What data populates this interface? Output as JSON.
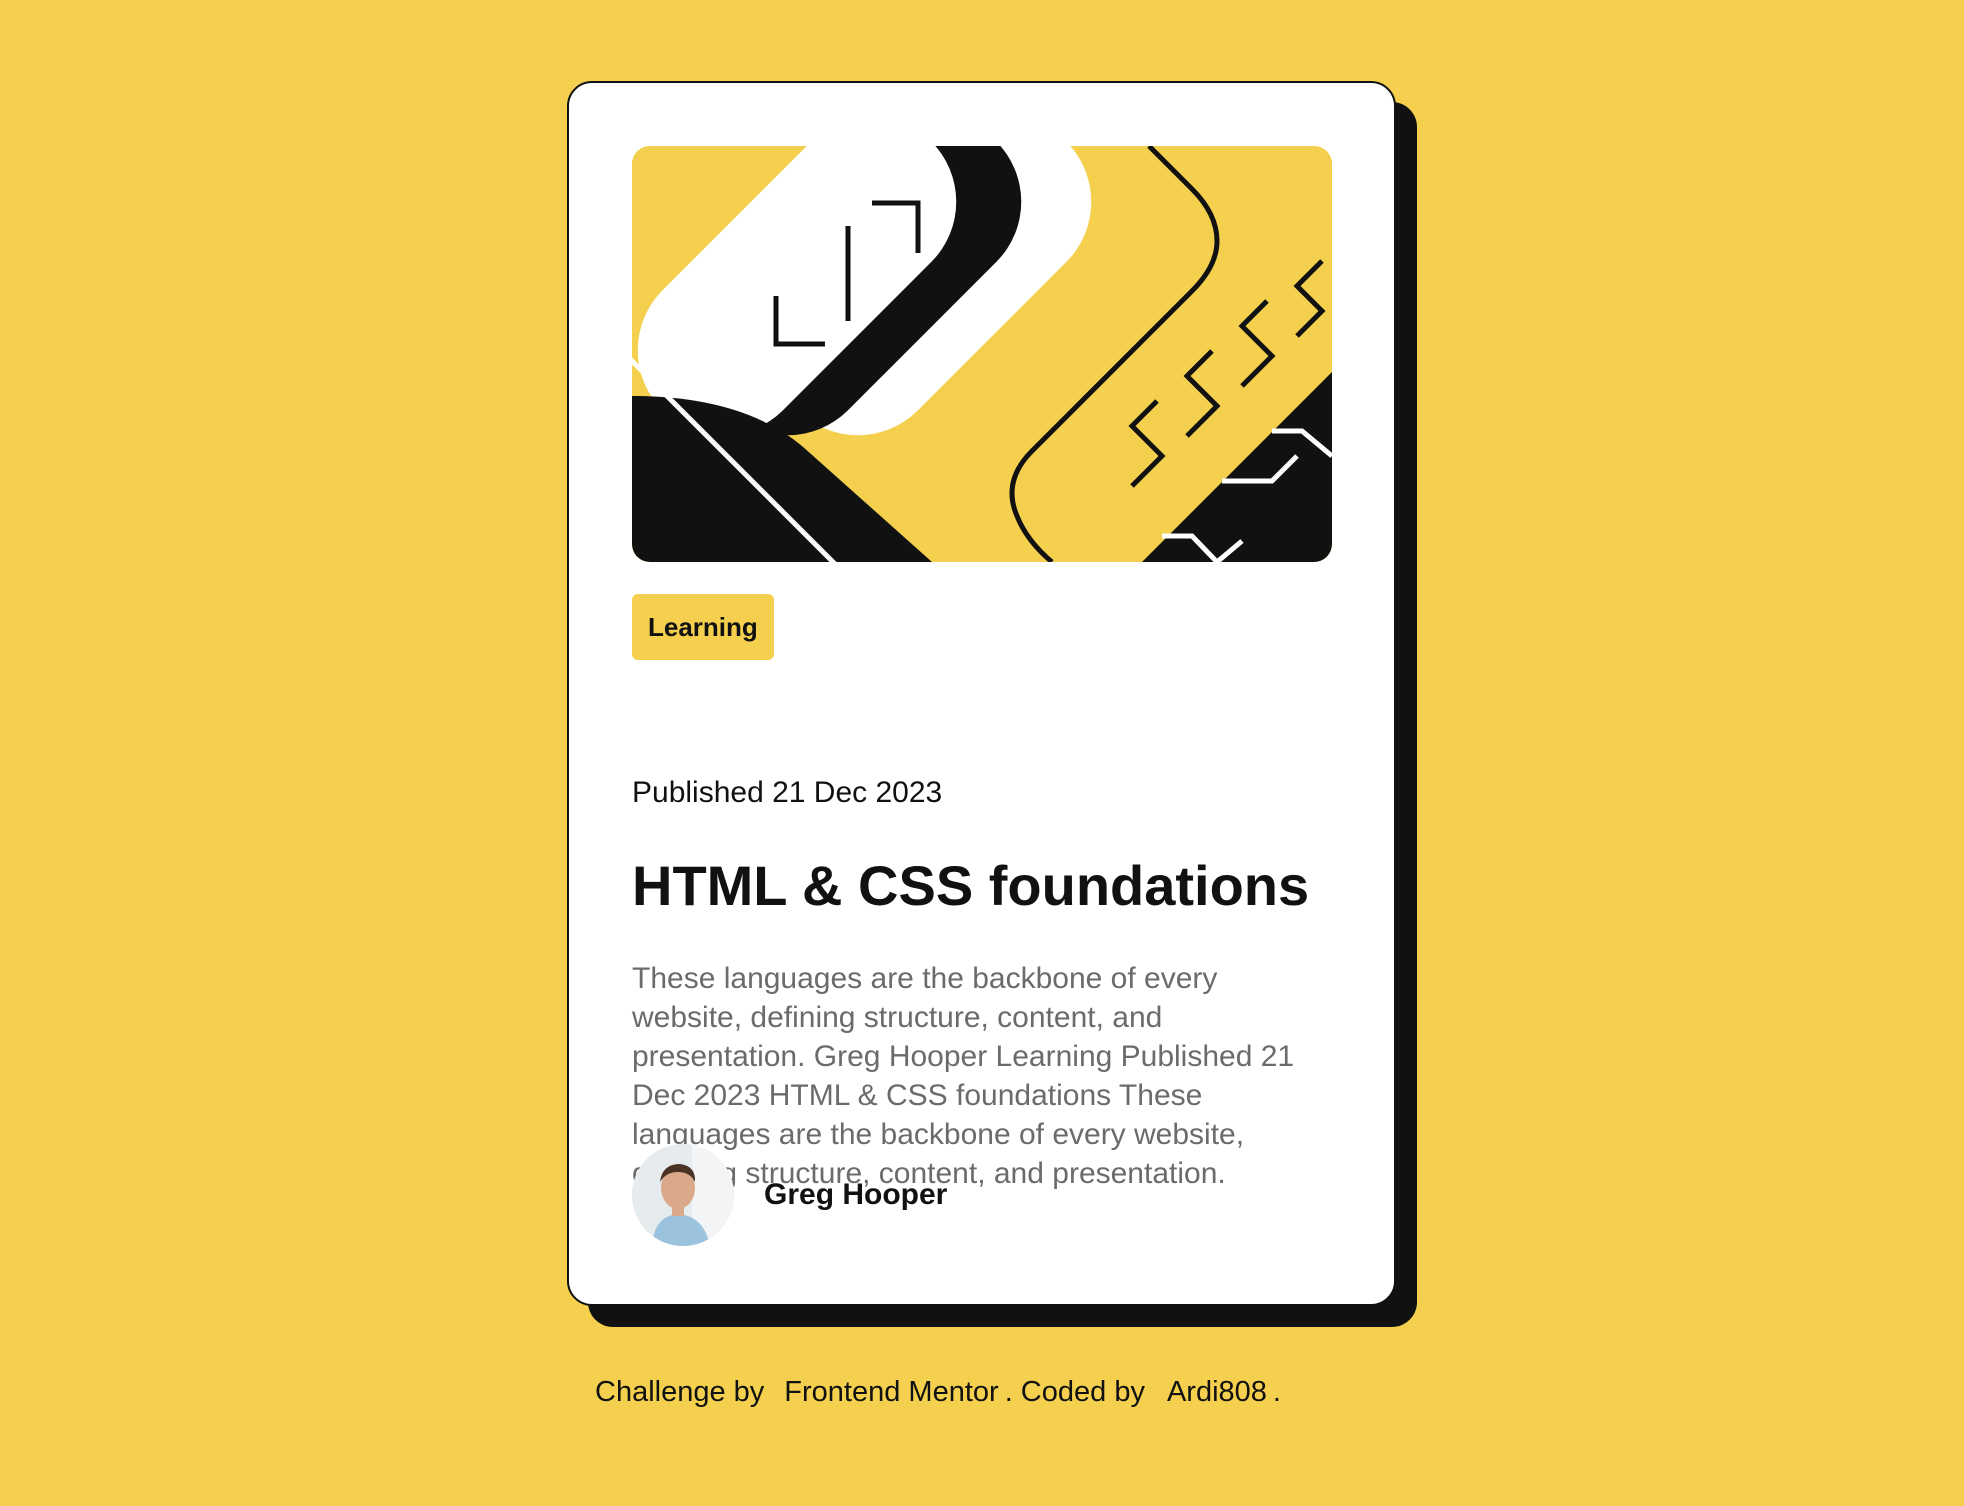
{
  "colors": {
    "background": "#F4D04E",
    "card": "#FFFFFF",
    "ink": "#111111",
    "muted_text": "#6B6B6B"
  },
  "hero": {
    "icon": "abstract-html-css-illustration"
  },
  "card": {
    "tag": "Learning",
    "published": "Published 21 Dec 2023",
    "title": "HTML & CSS foundations",
    "description": "These languages are the backbone of every website, defining structure, content, and presentation. Greg Hooper Learning Published 21 Dec 2023 HTML & CSS foundations These languages are the backbone of every website, defining structure, content, and presentation."
  },
  "author": {
    "name": "Greg Hooper",
    "avatar_icon": "person-avatar"
  },
  "attribution": {
    "prefix": "Challenge by",
    "challenge_link": "Frontend Mentor",
    "middle": ". Coded by",
    "coder_link": "Ardi808",
    "suffix": "."
  }
}
